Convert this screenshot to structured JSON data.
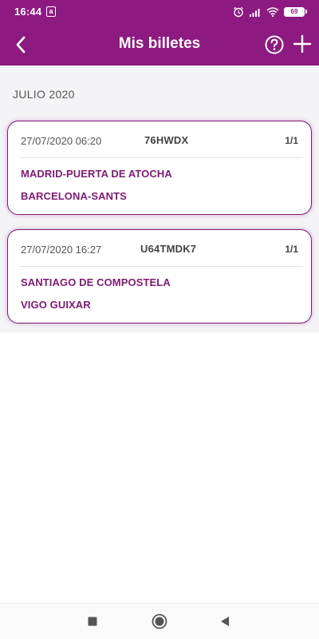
{
  "status_bar": {
    "time": "16:44",
    "app_icon_letter": "a",
    "battery_level": "69",
    "icons": [
      "alarm-icon",
      "signal-icon",
      "wifi-icon",
      "battery-icon"
    ]
  },
  "app_bar": {
    "title": "Mis billetes",
    "back_icon": "chevron-left-icon",
    "help_icon": "help-circle-icon",
    "add_icon": "plus-icon"
  },
  "section": {
    "month_label": "JULIO 2020"
  },
  "tickets": [
    {
      "datetime": "27/07/2020 06:20",
      "code": "76HWDX",
      "count": "1/1",
      "origin": "MADRID-PUERTA DE ATOCHA",
      "destination": "BARCELONA-SANTS"
    },
    {
      "datetime": "27/07/2020 16:27",
      "code": "U64TMDK7",
      "count": "1/1",
      "origin": "SANTIAGO DE COMPOSTELA",
      "destination": "VIGO GUIXAR"
    }
  ],
  "colors": {
    "brand_purple": "#8c1a80",
    "card_border": "#7d1b73",
    "station_text": "#7d1b73",
    "background": "#f4f4f6"
  },
  "nav_bar": {
    "icons": [
      "recent-apps-icon",
      "home-icon",
      "back-triangle-icon"
    ]
  }
}
